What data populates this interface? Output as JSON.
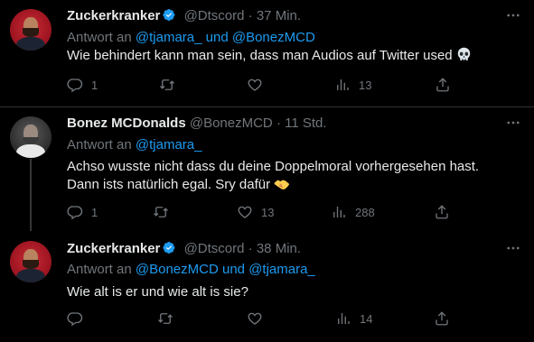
{
  "tweets": [
    {
      "name": "Zuckerkranker",
      "handle": "@Dtscord",
      "sep": "·",
      "time": "37 Min.",
      "reply_prefix": "Antwort an",
      "reply_to_1": "@tjamara_",
      "reply_joiner": "und",
      "reply_to_2": "@BonezMCD",
      "text": "Wie behindert kann man sein, dass man Audios auf Twitter used",
      "emoji": "skull",
      "counts": {
        "replies": "1",
        "retweets": "",
        "likes": "",
        "views": "13"
      }
    },
    {
      "name": "Bonez MCDonalds",
      "handle": "@BonezMCD",
      "sep": "·",
      "time": "11 Std.",
      "reply_prefix": "Antwort an",
      "reply_to_1": "@tjamara_",
      "text": "Achso wusste nicht dass du deine Doppelmoral vorhergesehen hast. Dann ists natürlich egal. Sry dafür",
      "emoji": "handshake",
      "counts": {
        "replies": "1",
        "retweets": "",
        "likes": "13",
        "views": "288"
      }
    },
    {
      "name": "Zuckerkranker",
      "handle": "@Dtscord",
      "sep": "·",
      "time": "38 Min.",
      "reply_prefix": "Antwort an",
      "reply_to_1": "@BonezMCD",
      "reply_joiner": "und",
      "reply_to_2": "@tjamara_",
      "text": "Wie alt is er und wie alt is sie?",
      "counts": {
        "replies": "",
        "retweets": "",
        "likes": "",
        "views": "14"
      }
    }
  ],
  "colors": {
    "background": "#000000",
    "text": "#e7e9ea",
    "muted": "#71767b",
    "link": "#1d9bf0",
    "divider": "#2f3336"
  },
  "icons": [
    "verified-badge-icon",
    "more-icon",
    "reply-icon",
    "retweet-icon",
    "like-icon",
    "views-icon",
    "share-icon",
    "skull-emoji",
    "handshake-emoji"
  ]
}
